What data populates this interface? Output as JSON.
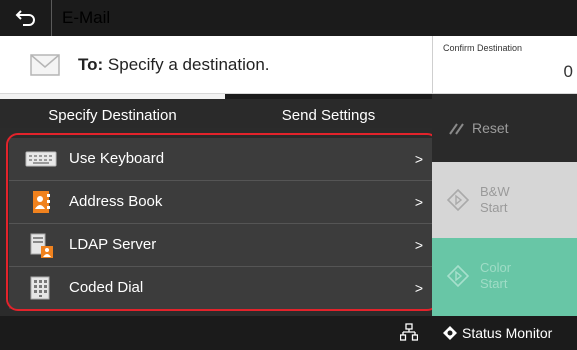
{
  "header": {
    "title": "E-Mail",
    "back_icon": "back-arrow-icon"
  },
  "destination": {
    "to_label": "To:",
    "to_placeholder": "Specify a destination.",
    "confirm_label": "Confirm Destination",
    "confirm_count": "0"
  },
  "tabs": [
    {
      "label": "Specify Destination",
      "selected": true
    },
    {
      "label": "Send Settings",
      "selected": false
    }
  ],
  "list": {
    "items": [
      {
        "label": "Use Keyboard",
        "icon": "keyboard-icon"
      },
      {
        "label": "Address Book",
        "icon": "address-book-icon"
      },
      {
        "label": "LDAP Server",
        "icon": "ldap-server-icon"
      },
      {
        "label": "Coded Dial",
        "icon": "coded-dial-icon"
      }
    ],
    "chevron": ">"
  },
  "side": {
    "reset_label": "Reset",
    "bw_label_1": "B&W",
    "bw_label_2": "Start",
    "color_label_1": "Color",
    "color_label_2": "Start"
  },
  "footer": {
    "status_monitor_label": "Status Monitor"
  },
  "colors": {
    "highlight_frame": "#e3232b",
    "color_start": "#68c6a6",
    "bw_start": "#d6d6d6",
    "dark": "#1b1b1b"
  }
}
